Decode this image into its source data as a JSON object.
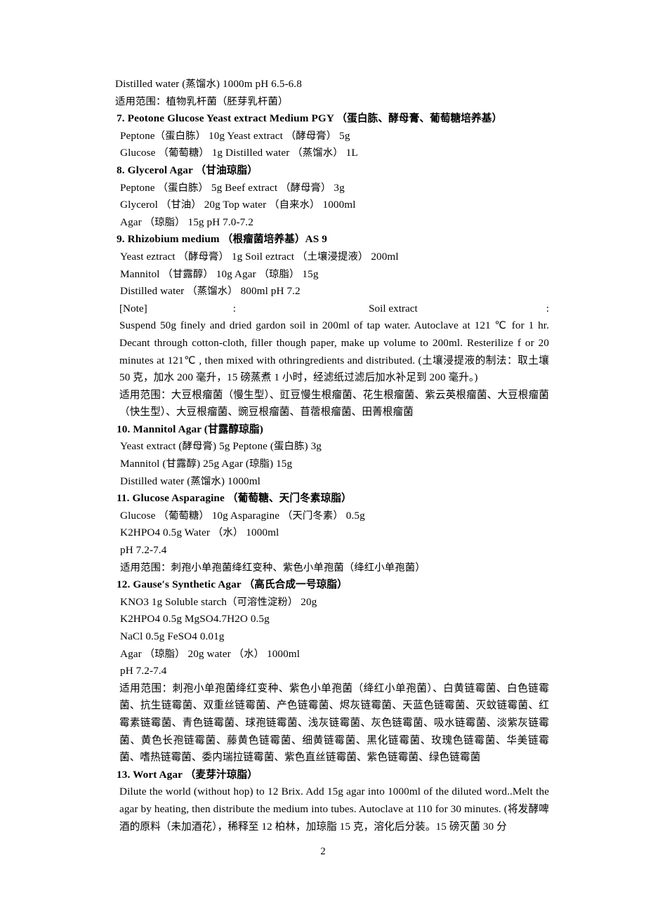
{
  "document": {
    "page_number": "2",
    "blocks": [
      {
        "kind": "line",
        "name": "line-distilled-water-ph",
        "text": "Distilled water (蒸馏水) 1000m pH 6.5-6.8"
      },
      {
        "kind": "line",
        "name": "line-scope-lactobacillus",
        "text": "适用范围：植物乳杆菌（胚芽乳杆菌）"
      },
      {
        "kind": "heading",
        "name": "heading-07-pgy",
        "text": "7. Peotone Glucose Yeast extract Medium PGY （蛋白胨、酵母膏、葡萄糖培养基）"
      },
      {
        "kind": "line-indent",
        "name": "line-pgy-peptone",
        "text": "Peptone（蛋白胨） 10g Yeast extract （酵母膏） 5g"
      },
      {
        "kind": "line-indent",
        "name": "line-pgy-glucose",
        "text": "Glucose （葡萄糖） 1g Distilled water （蒸馏水） 1L"
      },
      {
        "kind": "heading",
        "name": "heading-08-glycerol-agar",
        "text": "8. Glycerol Agar （甘油琼脂）"
      },
      {
        "kind": "line-indent",
        "name": "line-glycerol-peptone",
        "text": "Peptone （蛋白胨） 5g Beef extract （酵母膏） 3g"
      },
      {
        "kind": "line-indent",
        "name": "line-glycerol-glycerol",
        "text": "Glycerol （甘油） 20g Top water （自来水） 1000ml"
      },
      {
        "kind": "line-indent",
        "name": "line-glycerol-agar-ph",
        "text": "Agar （琼脂） 15g pH 7.0-7.2"
      },
      {
        "kind": "heading",
        "name": "heading-09-rhizobium-medium",
        "text": "9. Rhizobium medium （根瘤菌培养基）AS 9"
      },
      {
        "kind": "line-indent",
        "name": "line-rhizobium-yeast",
        "text": "Yeast eztract （酵母膏） 1g Soil eztract （土壤浸提液） 200ml"
      },
      {
        "kind": "line-indent",
        "name": "line-rhizobium-mannitol",
        "text": "Mannitol （甘露醇） 10g Agar （琼脂） 15g"
      },
      {
        "kind": "line-indent",
        "name": "line-rhizobium-water",
        "text": "Distilled water （蒸馏水） 800ml pH 7.2"
      },
      {
        "kind": "note-header",
        "name": "line-note-soil-extract",
        "parts": {
          "note_label": "[Note]",
          "colon_1": ":",
          "soil_extract": "Soil extract",
          "colon_2": ":"
        }
      },
      {
        "kind": "para",
        "name": "para-soil-extract-method",
        "text": "Suspend 50g finely and dried gardon soil in 200ml of tap water. Autoclave at 121 ℃ for 1 hr. Decant through cotton-cloth, filler though paper, make up volume to 200ml. Resterilize f or 20 minutes at 121℃ , then mixed with othringredients and distributed. (土壤浸提液的制法：取土壤 50 克，加水 200 毫升，15 磅蒸煮 1 小时，经滤纸过滤后加水补足到 200 毫升。)"
      },
      {
        "kind": "para",
        "name": "para-scope-rhizobium",
        "text": "适用范围：大豆根瘤菌（慢生型）、豇豆慢生根瘤菌、花生根瘤菌、紫云英根瘤菌、大豆根瘤菌（快生型）、大豆根瘤菌、豌豆根瘤菌、苜蓿根瘤菌、田菁根瘤菌"
      },
      {
        "kind": "heading",
        "name": "heading-10-mannitol-agar",
        "text": "10. Mannitol Agar (甘露醇琼脂)"
      },
      {
        "kind": "line-indent",
        "name": "line-mannitol-yeast",
        "text": "Yeast extract (酵母膏) 5g Peptone (蛋白胨) 3g"
      },
      {
        "kind": "line-indent",
        "name": "line-mannitol-mannitol",
        "text": "Mannitol (甘露醇) 25g Agar (琼脂) 15g"
      },
      {
        "kind": "line-indent",
        "name": "line-mannitol-water",
        "text": "Distilled water (蒸馏水) 1000ml"
      },
      {
        "kind": "heading",
        "name": "heading-11-glucose-asparagine",
        "text": "11. Glucose Asparagine （葡萄糖、天门冬素琼脂）"
      },
      {
        "kind": "line-indent",
        "name": "line-asparagine-glucose",
        "text": "Glucose （葡萄糖） 10g Asparagine （天门冬素） 0.5g"
      },
      {
        "kind": "line-indent",
        "name": "line-asparagine-k2hpo4",
        "text": "K2HPO4 0.5g Water （水） 1000ml"
      },
      {
        "kind": "line-indent",
        "name": "line-asparagine-ph",
        "text": "pH 7.2-7.4"
      },
      {
        "kind": "line-indent",
        "name": "line-scope-micromonospora",
        "text": "适用范围：刺孢小单孢菌绛红变种、紫色小单孢菌（绛红小单孢菌）"
      },
      {
        "kind": "heading",
        "name": "heading-12-gause-synthetic-agar",
        "text": "12. Gause′s Synthetic Agar （高氏合成一号琼脂）"
      },
      {
        "kind": "line-indent",
        "name": "line-gause-kno3",
        "text": "KNO3 1g Soluble starch（可溶性淀粉） 20g"
      },
      {
        "kind": "line-indent",
        "name": "line-gause-k2hpo4",
        "text": "K2HPO4 0.5g MgSO4.7H2O 0.5g"
      },
      {
        "kind": "line-indent",
        "name": "line-gause-nacl",
        "text": "NaCl 0.5g FeSO4 0.01g"
      },
      {
        "kind": "line-indent",
        "name": "line-gause-agar",
        "text": "Agar （琼脂） 20g water （水） 1000ml"
      },
      {
        "kind": "line-indent",
        "name": "line-gause-ph",
        "text": "pH 7.2-7.4"
      },
      {
        "kind": "para",
        "name": "para-scope-streptomyces",
        "text": "适用范围：刺孢小单孢菌绛红变种、紫色小单孢菌（绛红小单孢菌）、白黄链霉菌、白色链霉菌、抗生链霉菌、双重丝链霉菌、产色链霉菌、烬灰链霉菌、天蓝色链霉菌、灭蚊链霉菌、红霉素链霉菌、青色链霉菌、球孢链霉菌、浅灰链霉菌、灰色链霉菌、吸水链霉菌、淡紫灰链霉菌、黄色长孢链霉菌、藤黄色链霉菌、细黄链霉菌、黑化链霉菌、玫瑰色链霉菌、华美链霉菌、嗜热链霉菌、委内瑞拉链霉菌、紫色直丝链霉菌、紫色链霉菌、绿色链霉菌"
      },
      {
        "kind": "heading",
        "name": "heading-13-wort-agar",
        "text": "13. Wort Agar （麦芽汁琼脂）"
      },
      {
        "kind": "para",
        "name": "para-wort-agar-method",
        "text": "Dilute the world (without hop) to 12 Brix. Add 15g agar into 1000ml of the diluted word..Melt the agar by heating, then distribute the medium into tubes. Autoclave at 110 for 30 minutes. (将发酵啤酒的原料（未加酒花），稀释至 12 柏林，加琼脂 15 克，溶化后分装。15 磅灭菌 30 分"
      }
    ]
  }
}
